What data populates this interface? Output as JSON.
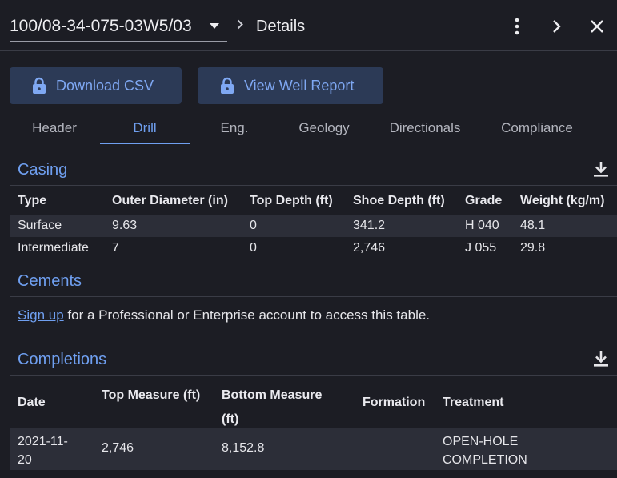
{
  "header": {
    "well_id": "100/08-34-075-03W5/03",
    "title": "Details"
  },
  "actions": {
    "download_csv": "Download CSV",
    "view_report": "View Well Report"
  },
  "tabs": [
    "Header",
    "Drill",
    "Eng.",
    "Geology",
    "Directionals",
    "Compliance"
  ],
  "active_tab": "Drill",
  "casing": {
    "title": "Casing",
    "columns": [
      "Type",
      "Outer Diameter (in)",
      "Top Depth (ft)",
      "Shoe Depth (ft)",
      "Grade",
      "Weight (kg/m)"
    ],
    "rows": [
      [
        "Surface",
        "9.63",
        "0",
        "341.2",
        "H 040",
        "48.1"
      ],
      [
        "Intermediate",
        "7",
        "0",
        "2,746",
        "J 055",
        "29.8"
      ]
    ]
  },
  "cements": {
    "title": "Cements",
    "link": "Sign up",
    "message": "for a Professional or Enterprise account to access this table."
  },
  "completions": {
    "title": "Completions",
    "columns": [
      "Date",
      "Top Measure (ft)",
      "Bottom Measure (ft)",
      "Formation",
      "Treatment"
    ],
    "rows": [
      [
        "2021-11-20",
        "2,746",
        "8,152.8",
        "",
        "OPEN-HOLE COMPLETION"
      ]
    ]
  },
  "colors": {
    "accent": "#6f9ff0",
    "button_bg": "#2c3a56",
    "background": "#1c1d24",
    "row_bg": "#2c2e38"
  },
  "icons": [
    "chevron-down-icon",
    "chevron-right-icon",
    "more-vertical-icon",
    "close-icon",
    "lock-icon",
    "download-icon"
  ]
}
